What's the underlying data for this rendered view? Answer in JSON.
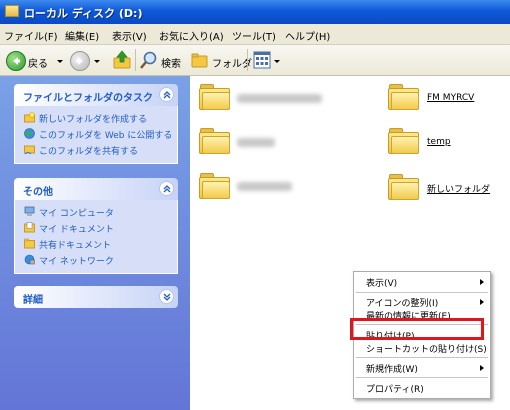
{
  "window": {
    "title": "ローカル ディスク (D:)"
  },
  "menu": [
    "ファイル(F)",
    "編集(E)",
    "表示(V)",
    "お気に入り(A)",
    "ツール(T)",
    "ヘルプ(H)"
  ],
  "toolbar": {
    "back": "戻る",
    "search": "検索",
    "folders": "フォルダ"
  },
  "tasks": {
    "title": "ファイルとフォルダのタスク",
    "items": [
      "新しいフォルダを作成する",
      "このフォルダを Web に公開する",
      "このフォルダを共有する"
    ]
  },
  "other": {
    "title": "その他",
    "items": [
      "マイ コンピュータ",
      "マイ ドキュメント",
      "共有ドキュメント",
      "マイ ネットワーク"
    ]
  },
  "details": {
    "title": "詳細"
  },
  "folders": [
    {
      "label": "",
      "obscured": true
    },
    {
      "label": "FM MYRCV",
      "obscured": false
    },
    {
      "label": "",
      "obscured": true
    },
    {
      "label": "temp",
      "obscured": false
    },
    {
      "label": "",
      "obscured": true
    },
    {
      "label": "新しいフォルダ",
      "obscured": false
    }
  ],
  "context_menu": {
    "items": [
      "表示(V)",
      "アイコンの整列(I)",
      "最新の情報に更新(E)",
      "貼り付け(P)",
      "ショートカットの貼り付け(S)",
      "新規作成(W)",
      "プロパティ(R)"
    ],
    "highlighted": "貼り付け(P)"
  },
  "colors": {
    "titlebar": "#0a49c4",
    "taskpane": "#6375d6",
    "highlight_box": "#e0161a",
    "link": "#215dc6"
  }
}
